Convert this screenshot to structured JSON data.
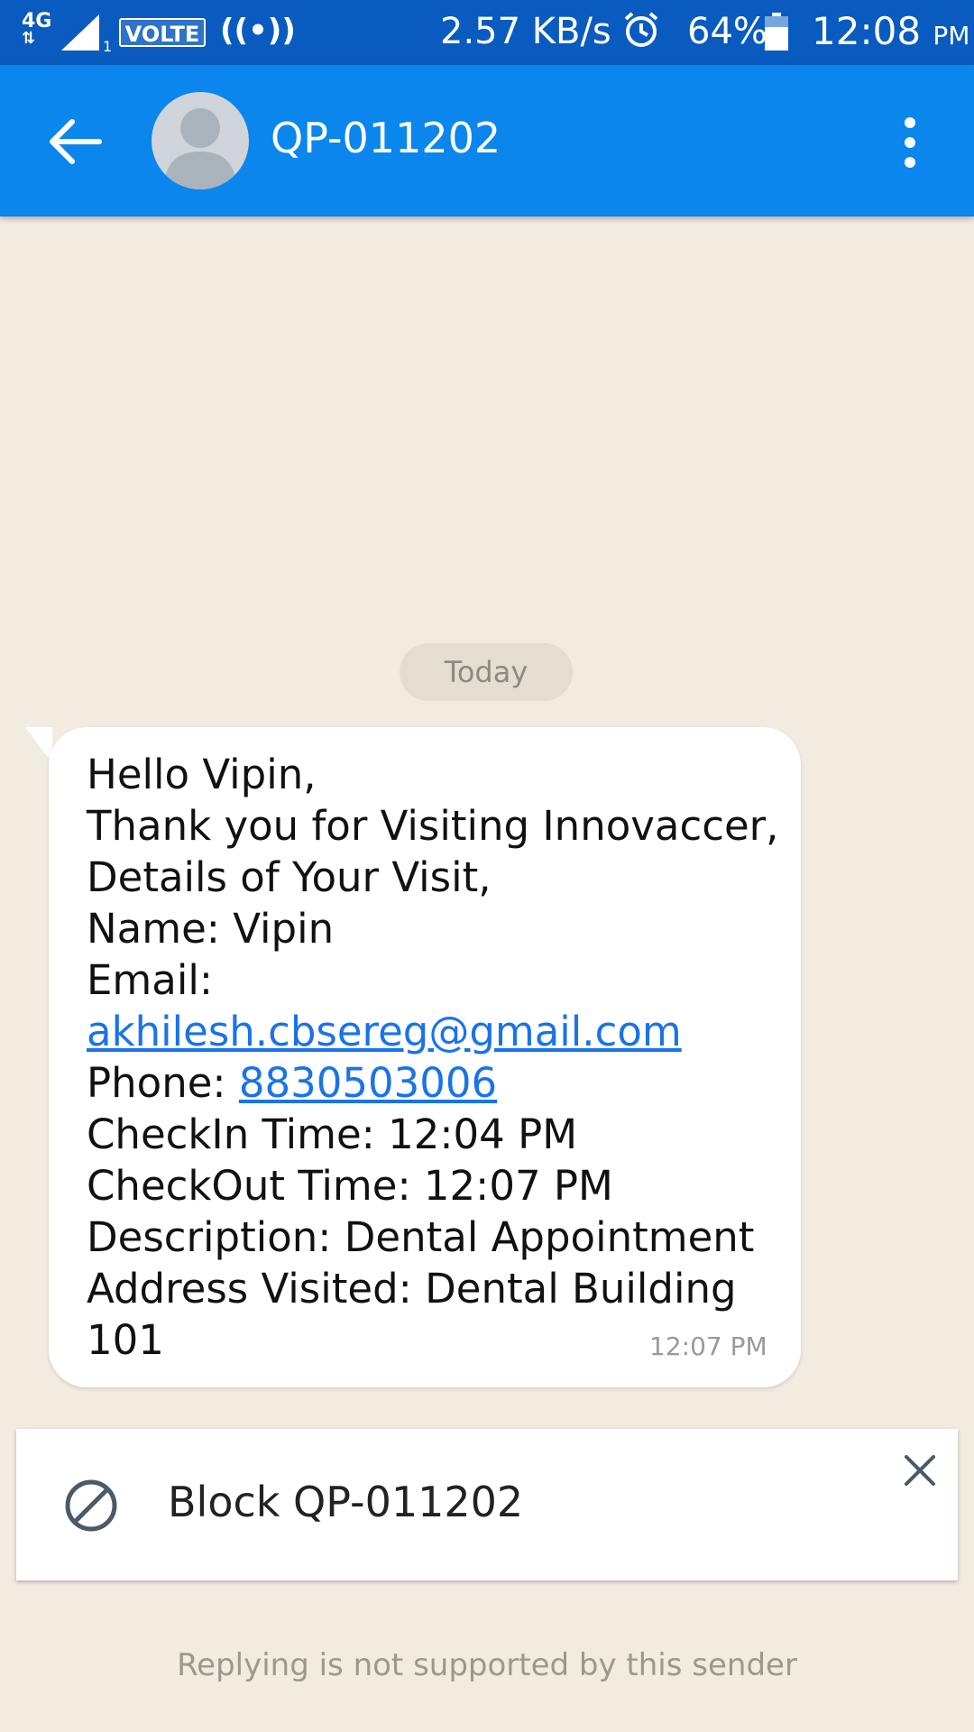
{
  "status_bar": {
    "network": "4G",
    "network_arrows": "⇅",
    "sim": "1",
    "volte": "VOLTE",
    "hotspot": "((•))",
    "speed": "2.57 KB/s",
    "battery": "64%",
    "time": "12:08",
    "ampm": "PM"
  },
  "app_bar": {
    "title": "QP-011202"
  },
  "conversation": {
    "date_label": "Today",
    "message": {
      "lines": [
        "Hello Vipin,",
        "Thank you for Visiting Innovaccer,",
        "Details of Your Visit,",
        "Name: Vipin",
        "Email:"
      ],
      "email": "akhilesh.cbsereg@gmail.com",
      "phone_label": "Phone: ",
      "phone": "8830503006",
      "lines_after": [
        "CheckIn Time: 12:04 PM",
        "CheckOut Time: 12:07 PM",
        "Description: Dental Appointment",
        "Address Visited: Dental Building",
        "101"
      ],
      "time": "12:07 PM"
    }
  },
  "block_card": {
    "label": "Block QP-011202"
  },
  "footer": {
    "reply_note": "Replying is not supported by this sender"
  },
  "colors": {
    "status_bar": "#0a5bbf",
    "app_bar": "#0a86ec",
    "background": "#f2ebe0",
    "link": "#1a73e8"
  }
}
